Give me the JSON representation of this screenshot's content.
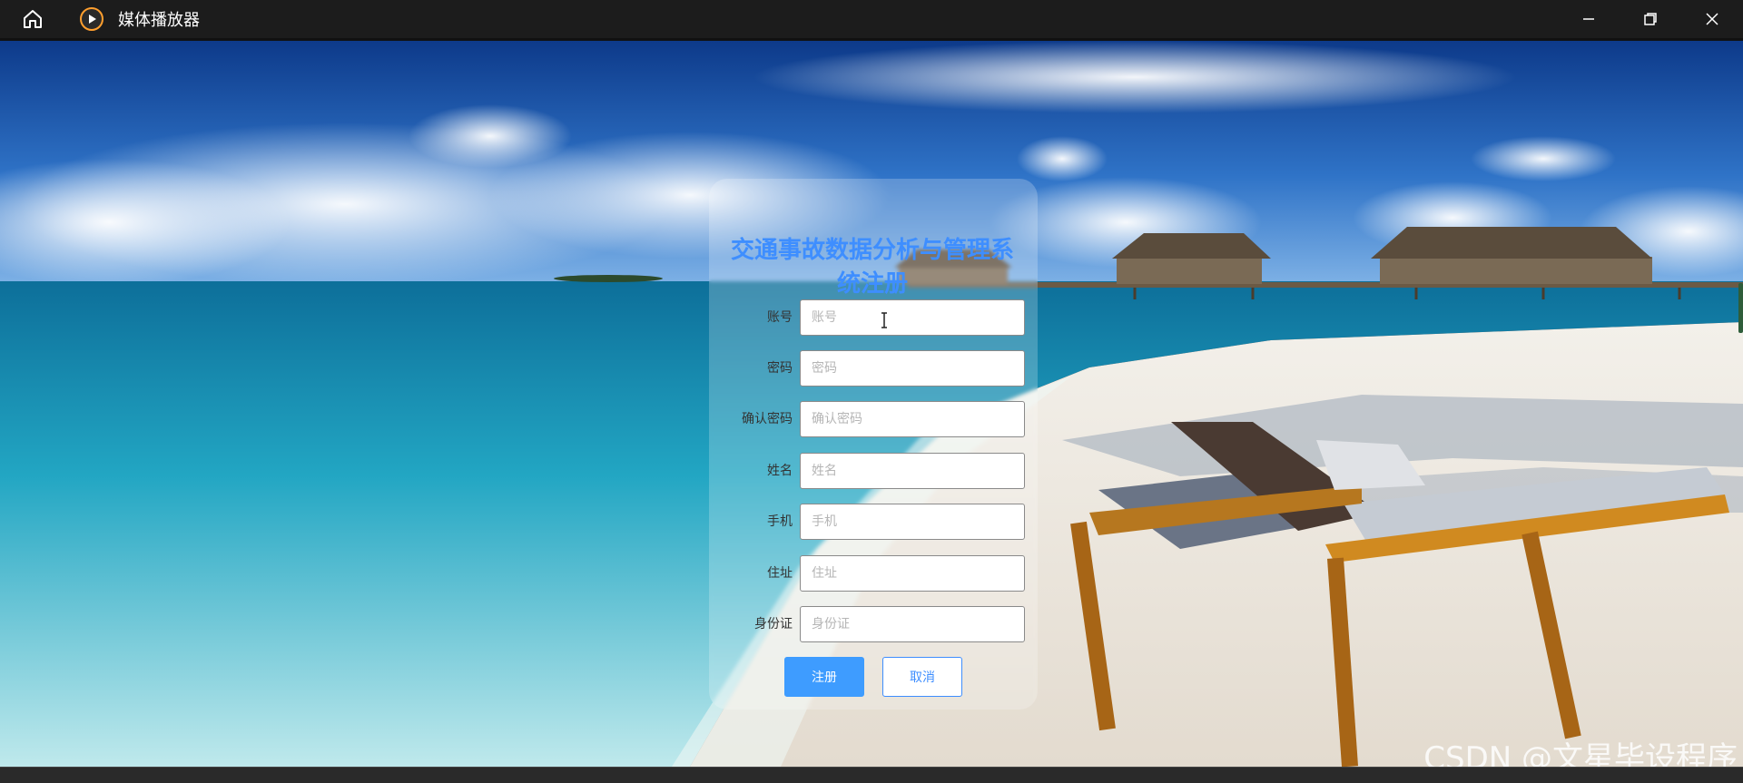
{
  "window": {
    "title": "媒体播放器",
    "accent": "#3e8eff"
  },
  "form": {
    "title": "交通事故数据分析与管理系统注册",
    "fields": [
      {
        "label": "账号",
        "placeholder": "账号",
        "value": ""
      },
      {
        "label": "密码",
        "placeholder": "密码",
        "value": ""
      },
      {
        "label": "确认密码",
        "placeholder": "确认密码",
        "value": ""
      },
      {
        "label": "姓名",
        "placeholder": "姓名",
        "value": ""
      },
      {
        "label": "手机",
        "placeholder": "手机",
        "value": ""
      },
      {
        "label": "住址",
        "placeholder": "住址",
        "value": ""
      },
      {
        "label": "身份证",
        "placeholder": "身份证",
        "value": ""
      }
    ],
    "register_label": "注册",
    "cancel_label": "取消"
  },
  "watermark": "CSDN @文星毕设程序"
}
